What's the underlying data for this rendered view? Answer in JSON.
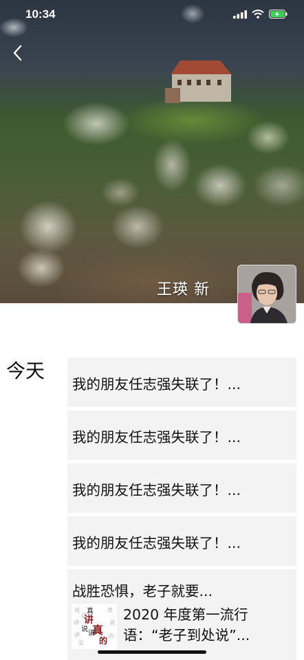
{
  "status_bar": {
    "time": "10:34"
  },
  "profile": {
    "name": "王瑛 新"
  },
  "timeline": {
    "day_label": "今天",
    "posts": [
      {
        "text": "我的朋友任志强失联了！..."
      },
      {
        "text": "我的朋友任志强失联了！..."
      },
      {
        "text": "我的朋友任志强失联了！..."
      },
      {
        "text": "我的朋友任志强失联了！..."
      }
    ],
    "article_post": {
      "text": "战胜恐惧，老子就要...",
      "article_title_line1": "2020 年度第一流行",
      "article_title_line2": "语：“老子到处说”...",
      "thumbnail_text": "讲真的"
    }
  }
}
